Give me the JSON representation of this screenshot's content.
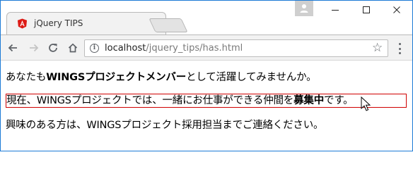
{
  "browser": {
    "tab": {
      "title": "jQuery TIPS",
      "close_glyph": "×"
    },
    "address": {
      "host": "localhost",
      "path": "/jquery_tips/has.html"
    },
    "icons": [
      "angular-favicon-icon",
      "back-arrow-icon",
      "forward-arrow-icon",
      "reload-icon",
      "home-icon",
      "info-icon",
      "star-icon",
      "menu-icon",
      "user-icon",
      "minimize-icon",
      "maximize-icon",
      "close-icon",
      "mouse-cursor-icon"
    ],
    "colors": {
      "accent_border": "#1c7ad6",
      "highlight_border": "#d00000",
      "favicon": "#dd1b16"
    }
  },
  "page": {
    "para1": {
      "pre": "あなたも",
      "strong": "WINGSプロジェクトメンバー",
      "post": "として活躍してみませんか。"
    },
    "para2": {
      "pre": "現在、WINGSプロジェクトでは、一緒にお仕事ができる仲間を",
      "strong": "募集中",
      "post": "です。"
    },
    "para3": {
      "text": "興味のある方は、WINGSプロジェクト採用担当までご連絡ください。"
    }
  }
}
